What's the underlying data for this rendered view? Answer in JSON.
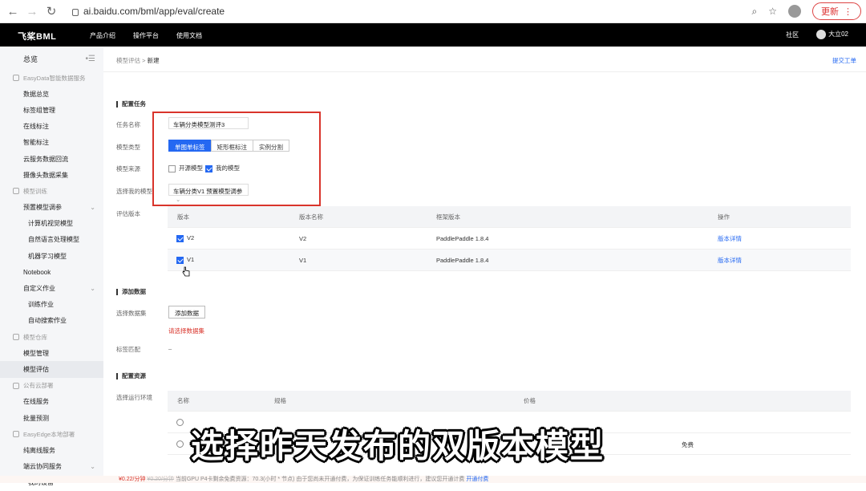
{
  "browser": {
    "url": "ai.baidu.com/bml/app/eval/create",
    "update_label": "更新"
  },
  "topnav": {
    "logo": "飞桨BML",
    "menu": [
      "产品介绍",
      "操作平台",
      "使用文档"
    ],
    "community": "社区",
    "user": "大立02"
  },
  "sidebar": {
    "overview": "总览",
    "items": [
      {
        "label": "EasyData智能数据服务",
        "kind": "group"
      },
      {
        "label": "数据总览",
        "kind": "item"
      },
      {
        "label": "标签组管理",
        "kind": "item"
      },
      {
        "label": "在线标注",
        "kind": "item"
      },
      {
        "label": "智能标注",
        "kind": "item"
      },
      {
        "label": "云服务数据回流",
        "kind": "item"
      },
      {
        "label": "摄像头数据采集",
        "kind": "item"
      },
      {
        "label": "模型训练",
        "kind": "group"
      },
      {
        "label": "预置模型调参",
        "kind": "item",
        "chevron": true
      },
      {
        "label": "计算机视觉模型",
        "kind": "sub"
      },
      {
        "label": "自然语言处理模型",
        "kind": "sub"
      },
      {
        "label": "机器学习模型",
        "kind": "sub"
      },
      {
        "label": "Notebook",
        "kind": "item"
      },
      {
        "label": "自定义作业",
        "kind": "item",
        "chevron": true
      },
      {
        "label": "训练作业",
        "kind": "sub"
      },
      {
        "label": "自动搜索作业",
        "kind": "sub"
      },
      {
        "label": "模型仓库",
        "kind": "group"
      },
      {
        "label": "模型管理",
        "kind": "item"
      },
      {
        "label": "模型评估",
        "kind": "item",
        "active": true
      },
      {
        "label": "公有云部署",
        "kind": "group"
      },
      {
        "label": "在线服务",
        "kind": "item"
      },
      {
        "label": "批量预测",
        "kind": "item"
      },
      {
        "label": "EasyEdge本地部署",
        "kind": "group"
      },
      {
        "label": "纯离线服务",
        "kind": "item"
      },
      {
        "label": "端云协同服务",
        "kind": "item",
        "chevron": true
      },
      {
        "label": "我的设备",
        "kind": "sub"
      }
    ]
  },
  "breadcrumb": {
    "parent": "模型评估",
    "sep": ">",
    "current": "新建"
  },
  "submit_ticket": "提交工单",
  "config": {
    "section_title": "配置任务",
    "task_name_label": "任务名称",
    "task_name_value": "车辆分类模型测评3",
    "model_type_label": "模型类型",
    "model_types": [
      "单图单标签",
      "矩形框标注",
      "实例分割"
    ],
    "model_source_label": "模型来源",
    "source_open": "开源模型",
    "source_mine": "我的模型",
    "select_model_label": "选择我的模型",
    "select_model_value": "车辆分类V1 预置模型调参",
    "eval_version_label": "评估版本"
  },
  "version_table": {
    "headers": [
      "版本",
      "版本名称",
      "框架版本",
      "操作"
    ],
    "rows": [
      {
        "version": "V2",
        "name": "V2",
        "framework": "PaddlePaddle 1.8.4",
        "action": "版本详情"
      },
      {
        "version": "V1",
        "name": "V1",
        "framework": "PaddlePaddle 1.8.4",
        "action": "版本详情"
      }
    ]
  },
  "add_data": {
    "section_title": "添加数据",
    "select_dataset_label": "选择数据集",
    "add_button": "添加数据",
    "error": "请选择数据集",
    "tag_match_label": "标签匹配",
    "tag_match_value": "–"
  },
  "resources": {
    "section_title": "配置资源",
    "env_label": "选择运行环境",
    "headers": [
      "名称",
      "规格",
      "价格"
    ],
    "partial_price": "免费"
  },
  "footer": {
    "price": "¥0.22/分钟",
    "original_price": "¥0.20/分钟",
    "text": "当前GPU P4卡剩余免费资源：70.3(小时 * 节点) 由于您尚未开通付费，为保证训练任务能顺利进行，建议您开通计费",
    "link": "开通付费"
  },
  "caption": "选择昨天发布的双版本模型"
}
